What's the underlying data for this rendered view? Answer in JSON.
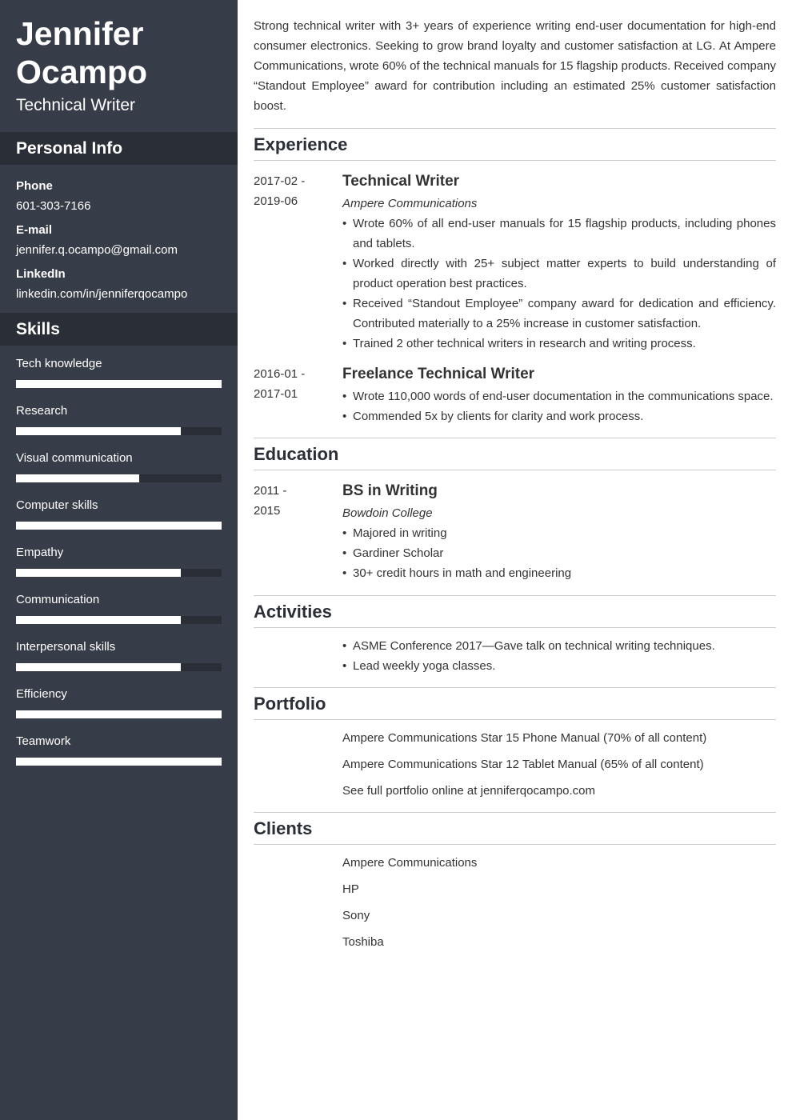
{
  "sidebar": {
    "name_first": "Jennifer",
    "name_last": "Ocampo",
    "role": "Technical Writer",
    "personal_info_title": "Personal Info",
    "info": [
      {
        "label": "Phone",
        "value": "601-303-7166"
      },
      {
        "label": "E-mail",
        "value": "jennifer.q.ocampo@gmail.com"
      },
      {
        "label": "LinkedIn",
        "value": "linkedin.com/in/jenniferqocampo"
      }
    ],
    "skills_title": "Skills",
    "skills": [
      {
        "label": "Tech knowledge",
        "level": 1.0
      },
      {
        "label": "Research",
        "level": 0.8
      },
      {
        "label": "Visual communication",
        "level": 0.6
      },
      {
        "label": "Computer skills",
        "level": 1.0
      },
      {
        "label": "Empathy",
        "level": 0.8
      },
      {
        "label": "Communication",
        "level": 0.8
      },
      {
        "label": "Interpersonal skills",
        "level": 0.8
      },
      {
        "label": "Efficiency",
        "level": 1.0
      },
      {
        "label": "Teamwork",
        "level": 1.0
      }
    ]
  },
  "main": {
    "summary": "Strong technical writer with 3+ years of experience writing end-user documentation for high-end consumer electronics. Seeking to grow brand loyalty and customer satisfaction at LG. At Ampere Communications, wrote 60% of the technical manuals for 15 flagship products. Received company “Standout Employee” award for contribution including an estimated 25% customer satisfaction boost.",
    "experience_title": "Experience",
    "experience": [
      {
        "date_start": "2017-02 -",
        "date_end": "2019-06",
        "title": "Technical Writer",
        "org": "Ampere Communications",
        "bullets": [
          "Wrote 60% of all end-user manuals for 15 flagship products, including phones and tablets.",
          "Worked directly with 25+ subject matter experts to build understanding of product operation best practices.",
          "Received “Standout Employee” company award for dedication and efficiency. Contributed materially to a 25% increase in customer satisfaction.",
          "Trained 2 other technical writers in research and writing process."
        ]
      },
      {
        "date_start": "2016-01 -",
        "date_end": "2017-01",
        "title": "Freelance Technical Writer",
        "org": "",
        "bullets": [
          "Wrote 110,000 words of end-user documentation in the communications space.",
          "Commended 5x by clients for clarity and work process."
        ]
      }
    ],
    "education_title": "Education",
    "education": {
      "date_start": "2011 -",
      "date_end": "2015",
      "title": "BS in Writing",
      "org": "Bowdoin College",
      "bullets": [
        "Majored in writing",
        "Gardiner Scholar",
        "30+ credit hours in math and engineering"
      ]
    },
    "activities_title": "Activities",
    "activities": [
      "ASME Conference 2017—Gave talk on technical writing techniques.",
      "Lead weekly yoga classes."
    ],
    "portfolio_title": "Portfolio",
    "portfolio": [
      "Ampere Communications Star 15 Phone Manual (70% of all content)",
      "Ampere Communications Star 12 Tablet Manual (65% of all content)",
      "See full portfolio online at jenniferqocampo.com"
    ],
    "clients_title": "Clients",
    "clients": [
      "Ampere Communications",
      "HP",
      "Sony",
      "Toshiba"
    ]
  }
}
